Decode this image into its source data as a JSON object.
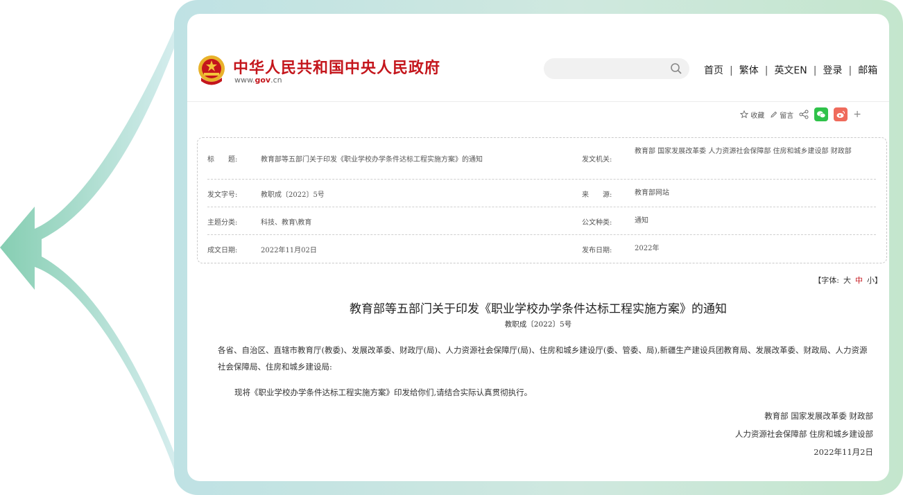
{
  "header": {
    "site_title": "中华人民共和国中央人民政府",
    "site_url_prefix": "www.",
    "site_url_gov": "gov",
    "site_url_suffix": ".cn",
    "search_placeholder": "",
    "nav": [
      "首页",
      "繁体",
      "英文EN",
      "登录",
      "邮箱"
    ],
    "nav_separator": "|"
  },
  "toolbar": {
    "favorite": "收藏",
    "comment": "留言"
  },
  "info": [
    {
      "label": "标　　题:",
      "value": "教育部等五部门关于印发《职业学校办学条件达标工程实施方案》的通知",
      "label2": "发文机关:",
      "value2": "教育部 国家发展改革委 人力资源社会保障部 住房和城乡建设部 财政部"
    },
    {
      "label": "发文字号:",
      "value": "教职成〔2022〕5号",
      "label2": "来　　源:",
      "value2": "教育部网站"
    },
    {
      "label": "主题分类:",
      "value": "科技、教育\\教育",
      "label2": "公文种类:",
      "value2": "通知"
    },
    {
      "label": "成文日期:",
      "value": "2022年11月02日",
      "label2": "发布日期:",
      "value2": "2022年"
    }
  ],
  "font_size": {
    "prefix": "【字体:",
    "options": [
      "大",
      "中",
      "小"
    ],
    "suffix": "】",
    "active": "中"
  },
  "article": {
    "title": "教育部等五部门关于印发《职业学校办学条件达标工程实施方案》的通知",
    "doc_no": "教职成〔2022〕5号",
    "addressee": "各省、自治区、直辖市教育厅(教委)、发展改革委、财政厅(局)、人力资源社会保障厅(局)、住房和城乡建设厅(委、管委、局),新疆生产建设兵团教育局、发展改革委、财政局、人力资源社会保障局、住房和城乡建设局:",
    "paragraph": "现将《职业学校办学条件达标工程实施方案》印发给你们,请结合实际认真贯彻执行。",
    "signature_line1": "教育部 国家发展改革委 财政部",
    "signature_line2": "人力资源社会保障部 住房和城乡建设部",
    "signature_date": "2022年11月2日"
  },
  "colors": {
    "brand_red": "#c4161c",
    "frame_left": "#bfe2e4",
    "frame_right": "#c4e6cd",
    "arrow": "#8fd0b6"
  }
}
